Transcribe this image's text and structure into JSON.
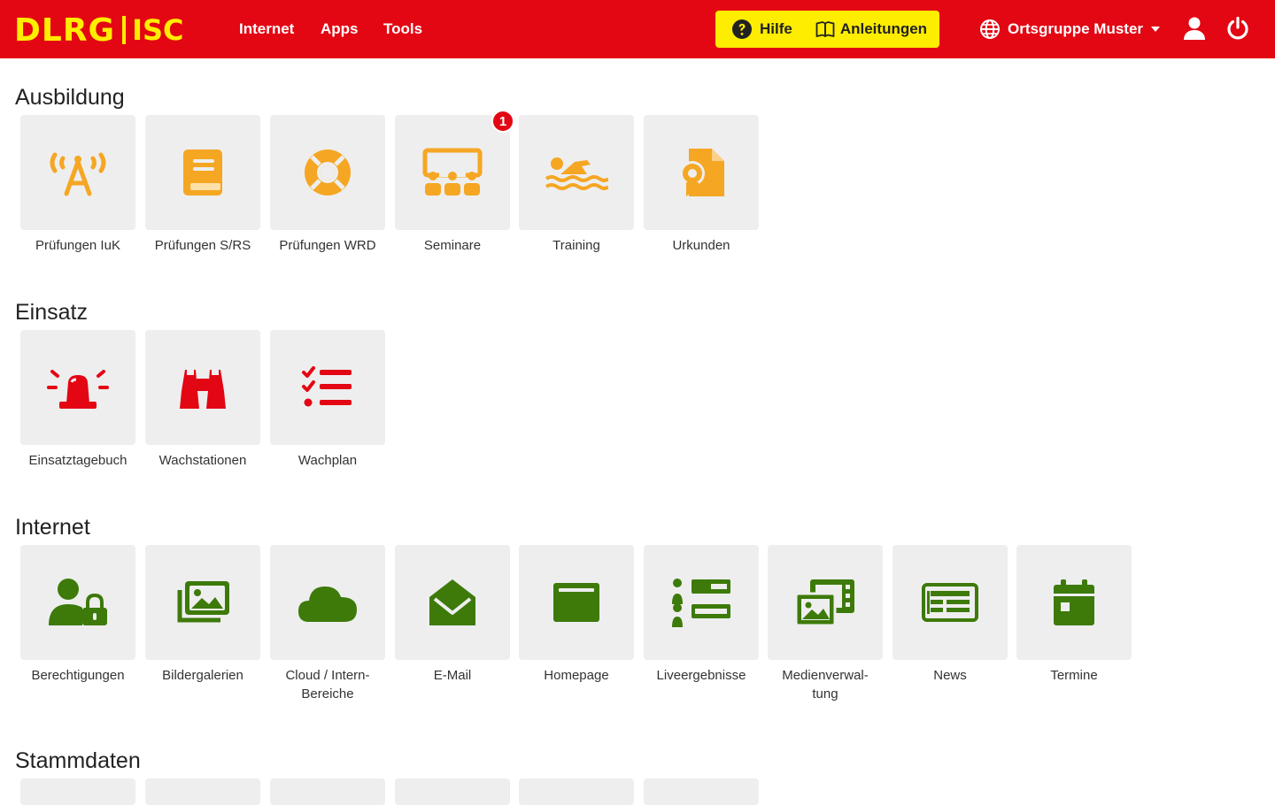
{
  "header": {
    "logo_dlrg": "DLRG",
    "logo_isc": "ISC",
    "nav": [
      "Internet",
      "Apps",
      "Tools"
    ],
    "help_label": "Hilfe",
    "guides_label": "Anleitungen",
    "org_label": "Ortsgruppe Muster"
  },
  "colors": {
    "brand_red": "#e30613",
    "brand_yellow": "#ffed00",
    "ausbildung_icon": "#f5a623",
    "einsatz_icon": "#e30613",
    "internet_icon": "#3d7a0a"
  },
  "sections": [
    {
      "title": "Ausbildung",
      "tiles": [
        {
          "label": "Prüfungen IuK",
          "icon": "antenna-icon"
        },
        {
          "label": "Prüfungen S/RS",
          "icon": "book-icon"
        },
        {
          "label": "Prüfungen WRD",
          "icon": "lifebuoy-icon"
        },
        {
          "label": "Seminare",
          "icon": "classroom-icon",
          "badge": "1"
        },
        {
          "label": "Training",
          "icon": "swimmer-icon"
        },
        {
          "label": "Urkunden",
          "icon": "certificate-icon"
        }
      ]
    },
    {
      "title": "Einsatz",
      "tiles": [
        {
          "label": "Einsatztagebuch",
          "icon": "siren-icon"
        },
        {
          "label": "Wachstationen",
          "icon": "binoculars-icon"
        },
        {
          "label": "Wachplan",
          "icon": "checklist-icon"
        }
      ]
    },
    {
      "title": "Internet",
      "tiles": [
        {
          "label": "Berechtigungen",
          "icon": "user-lock-icon"
        },
        {
          "label": "Bildergalerien",
          "icon": "images-icon"
        },
        {
          "label": "Cloud / Intern-Bereiche",
          "label_lines": [
            "Cloud / Intern-",
            "Bereiche"
          ],
          "icon": "cloud-icon"
        },
        {
          "label": "E-Mail",
          "icon": "envelope-open-icon"
        },
        {
          "label": "Homepage",
          "icon": "browser-window-icon"
        },
        {
          "label": "Liveergebnisse",
          "icon": "list-icon"
        },
        {
          "label": "Medienverwaltung",
          "label_lines": [
            "Medienverwal-",
            "tung"
          ],
          "icon": "media-icon"
        },
        {
          "label": "News",
          "icon": "newspaper-icon"
        },
        {
          "label": "Termine",
          "icon": "calendar-icon"
        }
      ]
    },
    {
      "title": "Stammdaten",
      "tiles": []
    }
  ]
}
